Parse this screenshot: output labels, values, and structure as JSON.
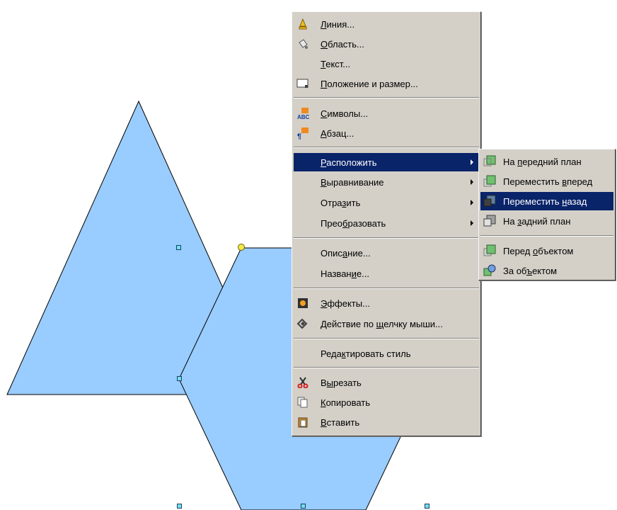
{
  "menu": {
    "items": [
      {
        "pre": "",
        "ul": "Л",
        "post": "иния...",
        "icon": "line-icon"
      },
      {
        "pre": "",
        "ul": "О",
        "post": "бласть...",
        "icon": "area-icon"
      },
      {
        "pre": "",
        "ul": "Т",
        "post": "екст...",
        "icon": ""
      },
      {
        "pre": "",
        "ul": "П",
        "post": "оложение и размер...",
        "icon": "position-size-icon"
      },
      {
        "pre": "",
        "ul": "С",
        "post": "имволы...",
        "icon": "characters-icon"
      },
      {
        "pre": "",
        "ul": "А",
        "post": "бзац...",
        "icon": "paragraph-icon"
      },
      {
        "pre": "",
        "ul": "Р",
        "post": "асположить",
        "icon": "",
        "submenu": true,
        "selected": true
      },
      {
        "pre": "",
        "ul": "В",
        "post": "ыравнивание",
        "icon": "",
        "submenu": true
      },
      {
        "pre": "Отра",
        "ul": "з",
        "post": "ить",
        "icon": "",
        "submenu": true
      },
      {
        "pre": "Прео",
        "ul": "б",
        "post": "разовать",
        "icon": "",
        "submenu": true
      },
      {
        "pre": "Опис",
        "ul": "а",
        "post": "ние...",
        "icon": ""
      },
      {
        "pre": "Назван",
        "ul": "и",
        "post": "е...",
        "icon": ""
      },
      {
        "pre": "",
        "ul": "Э",
        "post": "ффекты...",
        "icon": "effects-icon"
      },
      {
        "pre": "Действие по ",
        "ul": "щ",
        "post": "елчку мыши...",
        "icon": "interaction-icon"
      },
      {
        "pre": "Реда",
        "ul": "к",
        "post": "тировать стиль",
        "icon": ""
      },
      {
        "pre": "В",
        "ul": "ы",
        "post": "резать",
        "icon": "scissors-icon"
      },
      {
        "pre": "",
        "ul": "К",
        "post": "опировать",
        "icon": "copy-icon"
      },
      {
        "pre": "",
        "ul": "В",
        "post": "ставить",
        "icon": "paste-icon"
      }
    ]
  },
  "submenu": {
    "items": [
      {
        "pre": "На ",
        "ul": "п",
        "post": "ередний план",
        "icon": "bring-to-front-icon"
      },
      {
        "pre": "Переместить ",
        "ul": "в",
        "post": "перед",
        "icon": "bring-forward-icon"
      },
      {
        "pre": "Переместить ",
        "ul": "н",
        "post": "азад",
        "icon": "send-backward-icon",
        "selected": true
      },
      {
        "pre": "На ",
        "ul": "з",
        "post": "адний план",
        "icon": "send-to-back-icon"
      },
      {
        "pre": "Перед ",
        "ul": "о",
        "post": "бъектом",
        "icon": "in-front-of-object-icon"
      },
      {
        "pre": "За об",
        "ul": "ъ",
        "post": "ектом",
        "icon": "behind-object-icon"
      }
    ]
  },
  "colors": {
    "shape_fill": "#99ccff",
    "selection": "#0a246a",
    "menu_bg": "#d4d0c8"
  }
}
